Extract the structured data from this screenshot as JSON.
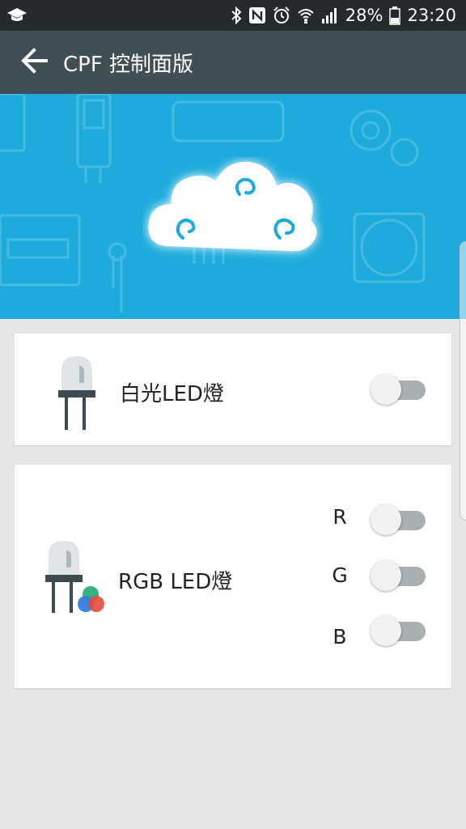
{
  "status_bar": {
    "battery_percent": "28%",
    "time": "23:20",
    "icons": [
      "graduation-cap-icon",
      "bluetooth-icon",
      "nfc-icon",
      "alarm-icon",
      "wifi-icon",
      "signal-icon",
      "battery-icon"
    ]
  },
  "app_bar": {
    "title": "CPF 控制面版",
    "back_icon": "arrow-back-icon"
  },
  "colors": {
    "status_bar": "#252a2d",
    "app_bar": "#404e56",
    "hero": "#1eabdc",
    "background": "#e6e6e6",
    "switch_track": "#a9b0b4"
  },
  "devices": [
    {
      "label": "白光LED燈",
      "icon": "led-icon",
      "switches": [
        {
          "channel": "",
          "on": false
        }
      ]
    },
    {
      "label": "RGB LED燈",
      "icon": "rgb-led-icon",
      "switches": [
        {
          "channel": "R",
          "on": false
        },
        {
          "channel": "G",
          "on": false
        },
        {
          "channel": "B",
          "on": false
        }
      ]
    }
  ]
}
